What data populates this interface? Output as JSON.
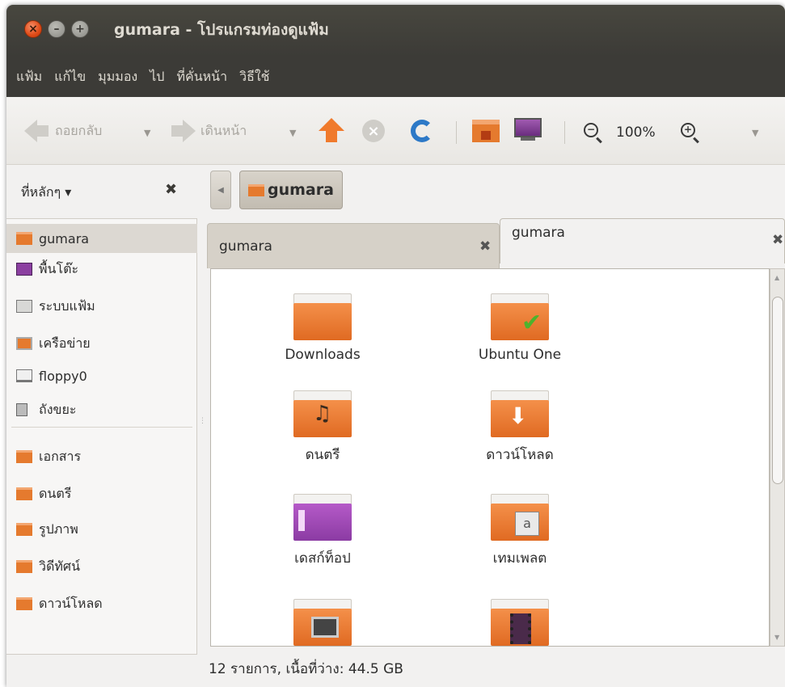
{
  "window": {
    "title": "gumara - โปรแกรมท่องดูแฟ้ม",
    "controls": {
      "close": "×",
      "minimize": "–",
      "maximize": "+"
    }
  },
  "menubar": [
    "แฟ้ม",
    "แก้ไข",
    "มุมมอง",
    "ไป",
    "ที่คั่นหน้า",
    "วิธีใช้"
  ],
  "toolbar": {
    "back_label": "ถอยกลับ",
    "forward_label": "เดินหน้า",
    "dropdown_glyph": "▼",
    "zoom_level": "100%",
    "zoom_out_glyph": "−",
    "zoom_in_glyph": "+"
  },
  "places": {
    "header": "ที่หลักๆ ▾",
    "close_glyph": "✖",
    "items": [
      {
        "label": "gumara",
        "icon": "home-folder-icon",
        "selected": true
      },
      {
        "label": "พื้นโต๊ะ",
        "icon": "desktop-icon"
      },
      {
        "label": "ระบบแฟ้ม",
        "icon": "filesystem-icon"
      },
      {
        "label": "เครือข่าย",
        "icon": "network-icon"
      },
      {
        "label": "floppy0",
        "icon": "floppy-icon"
      },
      {
        "label": "ถังขยะ",
        "icon": "trash-icon"
      },
      {
        "label": "เอกสาร",
        "icon": "documents-folder-icon"
      },
      {
        "label": "ดนตรี",
        "icon": "music-folder-icon"
      },
      {
        "label": "รูปภาพ",
        "icon": "pictures-folder-icon"
      },
      {
        "label": "วิดีทัศน์",
        "icon": "videos-folder-icon"
      },
      {
        "label": "ดาวน์โหลด",
        "icon": "downloads-folder-icon"
      }
    ]
  },
  "location": {
    "back_glyph": "◀",
    "crumb": "gumara"
  },
  "tabs": [
    {
      "label": "gumara",
      "active": false,
      "close_glyph": "✖"
    },
    {
      "label": "gumara",
      "active": true,
      "close_glyph": "✖"
    }
  ],
  "files": [
    {
      "label": "Downloads",
      "emblem": "none"
    },
    {
      "label": "Ubuntu One",
      "emblem": "check"
    },
    {
      "label": "ดนตรี",
      "emblem": "music"
    },
    {
      "label": "ดาวน์โหลด",
      "emblem": "download"
    },
    {
      "label": "เดสก์ท็อป",
      "emblem": "desktop"
    },
    {
      "label": "เทมเพลต",
      "emblem": "template"
    },
    {
      "label": "",
      "emblem": "pictures"
    },
    {
      "label": "",
      "emblem": "video"
    }
  ],
  "file_emblems": {
    "music": "♫",
    "check": "✔",
    "download": "⬇",
    "template": "a"
  },
  "status": "12 รายการ, เนื้อที่ว่าง: 44.5 GB",
  "colors": {
    "accent": "#e57a2e",
    "titlebar": "#3c3b37",
    "close_button": "#df4a16"
  }
}
